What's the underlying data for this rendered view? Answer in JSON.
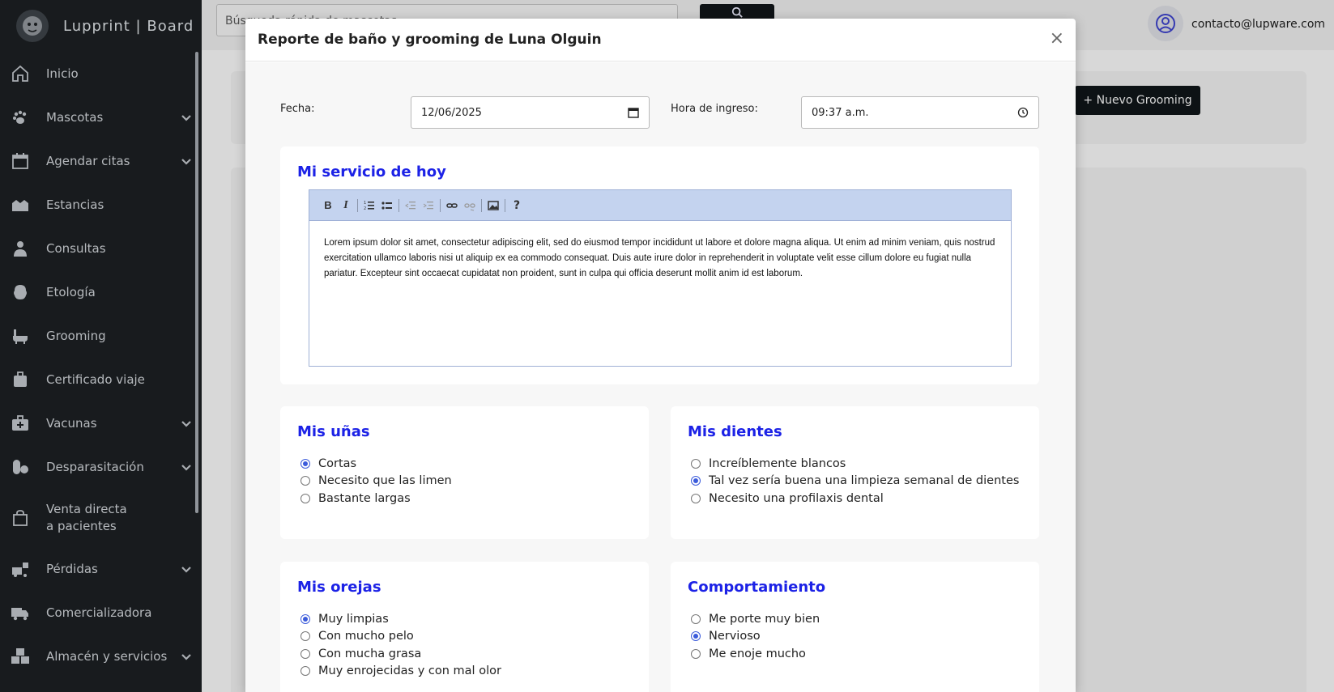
{
  "brand": {
    "name": "Lupprint | Board"
  },
  "sidebar": {
    "items": [
      {
        "label": "Inicio",
        "icon": "home-icon",
        "expandable": false
      },
      {
        "label": "Mascotas",
        "icon": "paw-icon",
        "expandable": true
      },
      {
        "label": "Agendar citas",
        "icon": "calendar-icon",
        "expandable": true
      },
      {
        "label": "Estancias",
        "icon": "hotel-icon",
        "expandable": false
      },
      {
        "label": "Consultas",
        "icon": "doctor-icon",
        "expandable": false
      },
      {
        "label": "Etología",
        "icon": "brain-icon",
        "expandable": false
      },
      {
        "label": "Grooming",
        "icon": "bath-icon",
        "expandable": false
      },
      {
        "label": "Certificado viaje",
        "icon": "suitcase-icon",
        "expandable": false
      },
      {
        "label": "Vacunas",
        "icon": "medkit-icon",
        "expandable": true
      },
      {
        "label": "Desparasitación",
        "icon": "pills-icon",
        "expandable": true
      },
      {
        "label": "Venta directa",
        "label2": "a pacientes",
        "icon": "shopping-bag-icon",
        "expandable": false
      },
      {
        "label": "Pérdidas",
        "icon": "truck-loading-icon",
        "expandable": true
      },
      {
        "label": "Comercializadora",
        "icon": "truck-icon",
        "expandable": false
      },
      {
        "label": "Almacén y servicios",
        "icon": "boxes-icon",
        "expandable": true
      }
    ]
  },
  "topbar": {
    "search_text": "Búsqueda rápida de mascotas",
    "user_email": "contacto@lupware.com"
  },
  "page": {
    "new_grooming_label": "+ Nuevo Grooming"
  },
  "modal": {
    "title": "Reporte de baño y grooming de Luna Olguin",
    "close": "×",
    "date_label": "Fecha:",
    "date_value": "12/06/2025",
    "time_label": "Hora de ingreso:",
    "time_value": "09:37 a.m."
  },
  "service": {
    "title": "Mi servicio de hoy",
    "toolbar": [
      "bold",
      "italic",
      "ordered-list",
      "unordered-list",
      "outdent",
      "indent",
      "link",
      "unlink",
      "image",
      "help"
    ],
    "content": "Lorem ipsum dolor sit amet, consectetur adipiscing elit, sed do eiusmod tempor incididunt ut labore et dolore magna aliqua. Ut enim ad minim veniam, quis nostrud exercitation ullamco laboris nisi ut aliquip ex ea commodo consequat. Duis aute irure dolor in reprehenderit in voluptate velit esse cillum dolore eu fugiat nulla pariatur. Excepteur sint occaecat cupidatat non proident, sunt in culpa qui officia deserunt mollit anim id est laborum."
  },
  "sections": {
    "nails": {
      "title": "Mis uñas",
      "options": [
        "Cortas",
        "Necesito que las limen",
        "Bastante largas"
      ],
      "selected": 0
    },
    "teeth": {
      "title": "Mis dientes",
      "options": [
        "Increíblemente blancos",
        "Tal vez sería buena una limpieza semanal de dientes",
        "Necesito una profilaxis dental"
      ],
      "selected": 1
    },
    "ears": {
      "title": "Mis orejas",
      "options": [
        "Muy limpias",
        "Con mucho pelo",
        "Con mucha grasa",
        "Muy enrojecidas y con mal olor"
      ],
      "selected": 0
    },
    "behavior": {
      "title": "Comportamiento",
      "options": [
        "Me porte muy bien",
        "Nervioso",
        "Me enoje mucho"
      ],
      "selected": 1
    }
  },
  "colors": {
    "accent": "#1c22e6",
    "sidebar": "#1a1e21",
    "radio": "#3b5bdb"
  }
}
